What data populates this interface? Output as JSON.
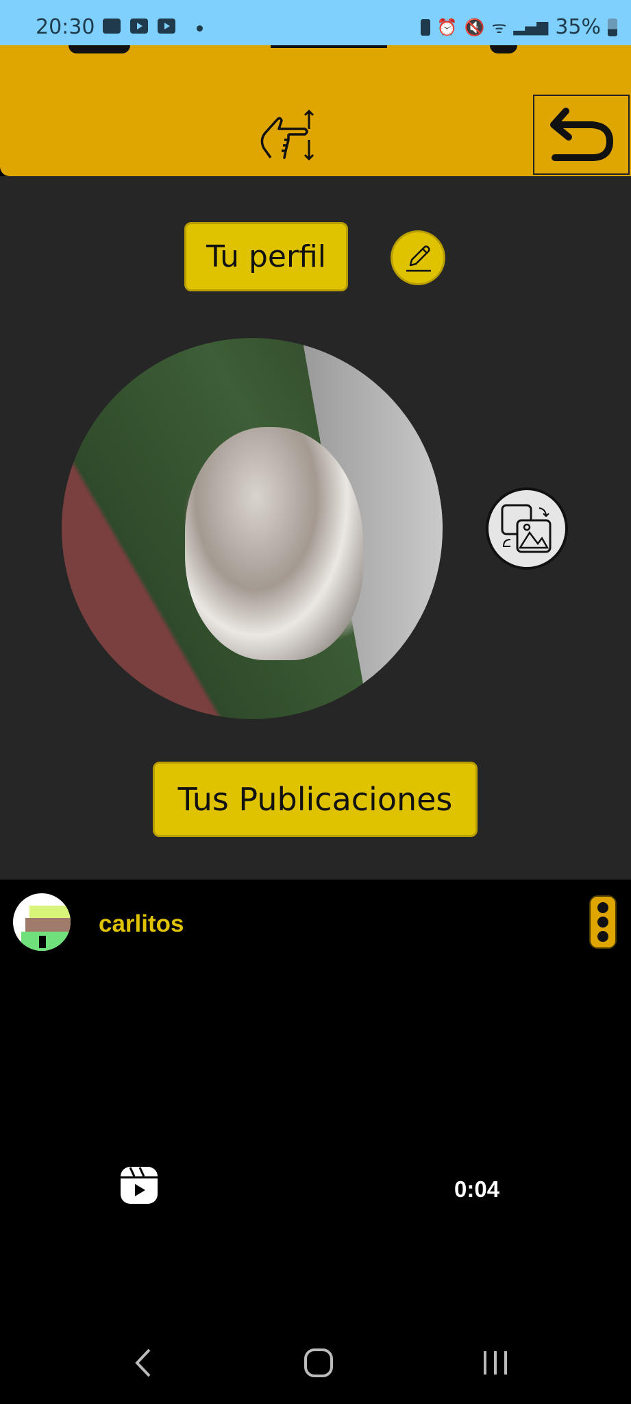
{
  "status_bar": {
    "time": "20:30",
    "battery": "35%",
    "icons": [
      "gallery-icon",
      "youtube-icon",
      "youtube-icon",
      "dot-icon",
      "battery-saver-icon",
      "alarm-icon",
      "mute-icon",
      "wifi-icon",
      "signal-icon",
      "battery-icon"
    ]
  },
  "header": {
    "scroll_icon": "hand-pointing-updown-icon",
    "back_icon": "undo-arrow-icon"
  },
  "profile": {
    "title_button": "Tu perfil",
    "edit_icon": "pencil-icon",
    "change_photo_icon": "swap-image-icon",
    "publications_button": "Tus Publicaciones"
  },
  "post": {
    "username": "carlitos",
    "menu_icon": "vertical-dots-icon",
    "reel_icon": "reels-icon",
    "duration": "0:04"
  },
  "nav_bar": {
    "items": [
      "back",
      "home",
      "recents"
    ]
  },
  "colors": {
    "status_bar": "#7fd0fd",
    "header": "#dfa500",
    "button": "#dfc300",
    "background": "#262626",
    "username": "#dfc300"
  }
}
